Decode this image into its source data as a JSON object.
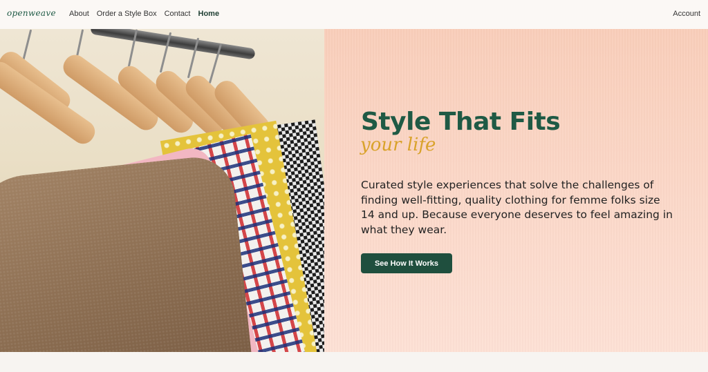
{
  "nav": {
    "logo": "openweave",
    "links": [
      "About",
      "Order a Style Box",
      "Contact",
      "Home"
    ],
    "active": "Home",
    "account": "Account"
  },
  "hero": {
    "headline": "Style That Fits",
    "script_line": "your life",
    "description": "Curated style experiences that solve the challenges of finding well-fitting, quality clothing for femme folks size 14 and up. Because everyone deserves to feel amazing in what they wear.",
    "cta_label": "See How It Works",
    "image_alt": "wooden hangers with colorful shirts and a tweed blazer on a clothing rack"
  },
  "colors": {
    "brand_green": "#1f5a45",
    "button_green": "#1f4f3e",
    "script_gold": "#d9a22a",
    "hero_pink": "#fbd7c7"
  }
}
